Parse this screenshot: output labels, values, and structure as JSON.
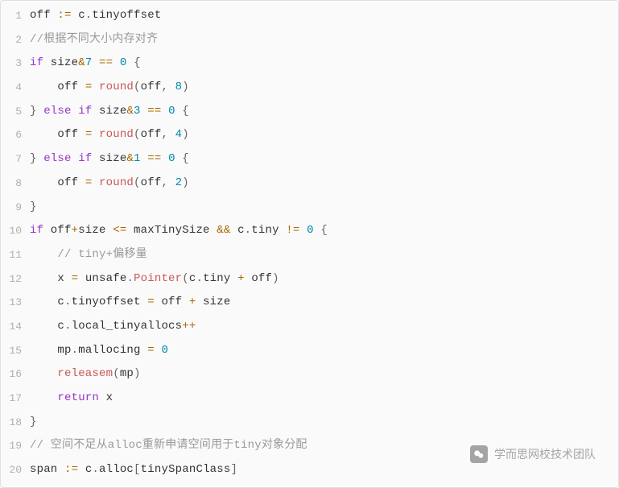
{
  "code": {
    "lines": [
      {
        "num": "1",
        "tokens": [
          {
            "t": "off ",
            "c": "tok-ident"
          },
          {
            "t": ":=",
            "c": "tok-op"
          },
          {
            "t": " c",
            "c": "tok-ident"
          },
          {
            "t": ".",
            "c": "tok-punct"
          },
          {
            "t": "tinyoffset",
            "c": "tok-ident"
          }
        ]
      },
      {
        "num": "2",
        "tokens": [
          {
            "t": "//根据不同大小内存对齐",
            "c": "tok-comment"
          }
        ]
      },
      {
        "num": "3",
        "tokens": [
          {
            "t": "if",
            "c": "tok-kw"
          },
          {
            "t": " size",
            "c": "tok-ident"
          },
          {
            "t": "&",
            "c": "tok-op"
          },
          {
            "t": "7",
            "c": "tok-num"
          },
          {
            "t": " ",
            "c": "tok-ident"
          },
          {
            "t": "==",
            "c": "tok-op"
          },
          {
            "t": " ",
            "c": "tok-ident"
          },
          {
            "t": "0",
            "c": "tok-num"
          },
          {
            "t": " {",
            "c": "tok-punct"
          }
        ]
      },
      {
        "num": "4",
        "tokens": [
          {
            "t": "    off ",
            "c": "tok-ident"
          },
          {
            "t": "=",
            "c": "tok-op"
          },
          {
            "t": " ",
            "c": "tok-ident"
          },
          {
            "t": "round",
            "c": "tok-func"
          },
          {
            "t": "(",
            "c": "tok-punct"
          },
          {
            "t": "off",
            "c": "tok-ident"
          },
          {
            "t": ", ",
            "c": "tok-punct"
          },
          {
            "t": "8",
            "c": "tok-num"
          },
          {
            "t": ")",
            "c": "tok-punct"
          }
        ]
      },
      {
        "num": "5",
        "tokens": [
          {
            "t": "} ",
            "c": "tok-punct"
          },
          {
            "t": "else",
            "c": "tok-kw"
          },
          {
            "t": " ",
            "c": "tok-ident"
          },
          {
            "t": "if",
            "c": "tok-kw"
          },
          {
            "t": " size",
            "c": "tok-ident"
          },
          {
            "t": "&",
            "c": "tok-op"
          },
          {
            "t": "3",
            "c": "tok-num"
          },
          {
            "t": " ",
            "c": "tok-ident"
          },
          {
            "t": "==",
            "c": "tok-op"
          },
          {
            "t": " ",
            "c": "tok-ident"
          },
          {
            "t": "0",
            "c": "tok-num"
          },
          {
            "t": " {",
            "c": "tok-punct"
          }
        ]
      },
      {
        "num": "6",
        "tokens": [
          {
            "t": "    off ",
            "c": "tok-ident"
          },
          {
            "t": "=",
            "c": "tok-op"
          },
          {
            "t": " ",
            "c": "tok-ident"
          },
          {
            "t": "round",
            "c": "tok-func"
          },
          {
            "t": "(",
            "c": "tok-punct"
          },
          {
            "t": "off",
            "c": "tok-ident"
          },
          {
            "t": ", ",
            "c": "tok-punct"
          },
          {
            "t": "4",
            "c": "tok-num"
          },
          {
            "t": ")",
            "c": "tok-punct"
          }
        ]
      },
      {
        "num": "7",
        "tokens": [
          {
            "t": "} ",
            "c": "tok-punct"
          },
          {
            "t": "else",
            "c": "tok-kw"
          },
          {
            "t": " ",
            "c": "tok-ident"
          },
          {
            "t": "if",
            "c": "tok-kw"
          },
          {
            "t": " size",
            "c": "tok-ident"
          },
          {
            "t": "&",
            "c": "tok-op"
          },
          {
            "t": "1",
            "c": "tok-num"
          },
          {
            "t": " ",
            "c": "tok-ident"
          },
          {
            "t": "==",
            "c": "tok-op"
          },
          {
            "t": " ",
            "c": "tok-ident"
          },
          {
            "t": "0",
            "c": "tok-num"
          },
          {
            "t": " {",
            "c": "tok-punct"
          }
        ]
      },
      {
        "num": "8",
        "tokens": [
          {
            "t": "    off ",
            "c": "tok-ident"
          },
          {
            "t": "=",
            "c": "tok-op"
          },
          {
            "t": " ",
            "c": "tok-ident"
          },
          {
            "t": "round",
            "c": "tok-func"
          },
          {
            "t": "(",
            "c": "tok-punct"
          },
          {
            "t": "off",
            "c": "tok-ident"
          },
          {
            "t": ", ",
            "c": "tok-punct"
          },
          {
            "t": "2",
            "c": "tok-num"
          },
          {
            "t": ")",
            "c": "tok-punct"
          }
        ]
      },
      {
        "num": "9",
        "tokens": [
          {
            "t": "}",
            "c": "tok-punct"
          }
        ]
      },
      {
        "num": "10",
        "tokens": [
          {
            "t": "if",
            "c": "tok-kw"
          },
          {
            "t": " off",
            "c": "tok-ident"
          },
          {
            "t": "+",
            "c": "tok-op"
          },
          {
            "t": "size ",
            "c": "tok-ident"
          },
          {
            "t": "<=",
            "c": "tok-op"
          },
          {
            "t": " maxTinySize ",
            "c": "tok-ident"
          },
          {
            "t": "&&",
            "c": "tok-op"
          },
          {
            "t": " c",
            "c": "tok-ident"
          },
          {
            "t": ".",
            "c": "tok-punct"
          },
          {
            "t": "tiny ",
            "c": "tok-ident"
          },
          {
            "t": "!=",
            "c": "tok-op"
          },
          {
            "t": " ",
            "c": "tok-ident"
          },
          {
            "t": "0",
            "c": "tok-num"
          },
          {
            "t": " {",
            "c": "tok-punct"
          }
        ]
      },
      {
        "num": "11",
        "tokens": [
          {
            "t": "    ",
            "c": "tok-ident"
          },
          {
            "t": "// tiny+偏移量",
            "c": "tok-comment"
          }
        ]
      },
      {
        "num": "12",
        "tokens": [
          {
            "t": "    x ",
            "c": "tok-ident"
          },
          {
            "t": "=",
            "c": "tok-op"
          },
          {
            "t": " unsafe",
            "c": "tok-ident"
          },
          {
            "t": ".",
            "c": "tok-punct"
          },
          {
            "t": "Pointer",
            "c": "tok-func"
          },
          {
            "t": "(",
            "c": "tok-punct"
          },
          {
            "t": "c",
            "c": "tok-ident"
          },
          {
            "t": ".",
            "c": "tok-punct"
          },
          {
            "t": "tiny ",
            "c": "tok-ident"
          },
          {
            "t": "+",
            "c": "tok-op"
          },
          {
            "t": " off",
            "c": "tok-ident"
          },
          {
            "t": ")",
            "c": "tok-punct"
          }
        ]
      },
      {
        "num": "13",
        "tokens": [
          {
            "t": "    c",
            "c": "tok-ident"
          },
          {
            "t": ".",
            "c": "tok-punct"
          },
          {
            "t": "tinyoffset ",
            "c": "tok-ident"
          },
          {
            "t": "=",
            "c": "tok-op"
          },
          {
            "t": " off ",
            "c": "tok-ident"
          },
          {
            "t": "+",
            "c": "tok-op"
          },
          {
            "t": " size",
            "c": "tok-ident"
          }
        ]
      },
      {
        "num": "14",
        "tokens": [
          {
            "t": "    c",
            "c": "tok-ident"
          },
          {
            "t": ".",
            "c": "tok-punct"
          },
          {
            "t": "local_tinyallocs",
            "c": "tok-ident"
          },
          {
            "t": "++",
            "c": "tok-op"
          }
        ]
      },
      {
        "num": "15",
        "tokens": [
          {
            "t": "    mp",
            "c": "tok-ident"
          },
          {
            "t": ".",
            "c": "tok-punct"
          },
          {
            "t": "mallocing ",
            "c": "tok-ident"
          },
          {
            "t": "=",
            "c": "tok-op"
          },
          {
            "t": " ",
            "c": "tok-ident"
          },
          {
            "t": "0",
            "c": "tok-num"
          }
        ]
      },
      {
        "num": "16",
        "tokens": [
          {
            "t": "    ",
            "c": "tok-ident"
          },
          {
            "t": "releasem",
            "c": "tok-func"
          },
          {
            "t": "(",
            "c": "tok-punct"
          },
          {
            "t": "mp",
            "c": "tok-ident"
          },
          {
            "t": ")",
            "c": "tok-punct"
          }
        ]
      },
      {
        "num": "17",
        "tokens": [
          {
            "t": "    ",
            "c": "tok-ident"
          },
          {
            "t": "return",
            "c": "tok-kw"
          },
          {
            "t": " x",
            "c": "tok-ident"
          }
        ]
      },
      {
        "num": "18",
        "tokens": [
          {
            "t": "}",
            "c": "tok-punct"
          }
        ]
      },
      {
        "num": "19",
        "tokens": [
          {
            "t": "// 空间不足从alloc重新申请空间用于tiny对象分配",
            "c": "tok-comment"
          }
        ]
      },
      {
        "num": "20",
        "tokens": [
          {
            "t": "span ",
            "c": "tok-ident"
          },
          {
            "t": ":=",
            "c": "tok-op"
          },
          {
            "t": " c",
            "c": "tok-ident"
          },
          {
            "t": ".",
            "c": "tok-punct"
          },
          {
            "t": "alloc",
            "c": "tok-ident"
          },
          {
            "t": "[",
            "c": "tok-punct"
          },
          {
            "t": "tinySpanClass",
            "c": "tok-ident"
          },
          {
            "t": "]",
            "c": "tok-punct"
          }
        ]
      }
    ]
  },
  "watermark": {
    "text": "学而思网校技术团队"
  }
}
